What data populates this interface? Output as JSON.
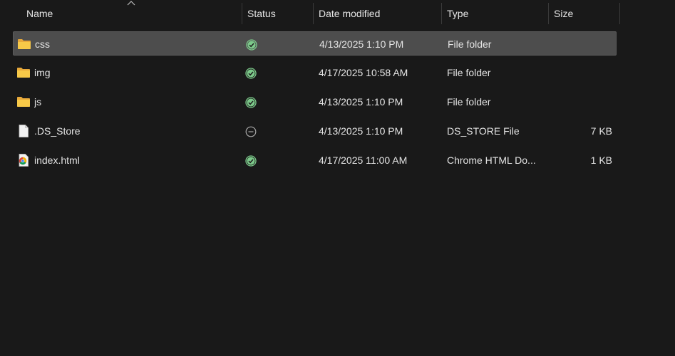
{
  "columns": {
    "name": "Name",
    "status": "Status",
    "date_modified": "Date modified",
    "type": "Type",
    "size": "Size"
  },
  "sort": {
    "column": "name",
    "direction": "ascending",
    "icon": "chevron-up-icon"
  },
  "files": [
    {
      "name": "css",
      "icon": "folder-icon",
      "status": "synced",
      "status_icon": "check-circle-icon",
      "date_modified": "4/13/2025 1:10 PM",
      "type": "File folder",
      "size": "",
      "selected": true
    },
    {
      "name": "img",
      "icon": "folder-icon",
      "status": "synced",
      "status_icon": "check-circle-icon",
      "date_modified": "4/17/2025 10:58 AM",
      "type": "File folder",
      "size": "",
      "selected": false
    },
    {
      "name": "js",
      "icon": "folder-icon",
      "status": "synced",
      "status_icon": "check-circle-icon",
      "date_modified": "4/13/2025 1:10 PM",
      "type": "File folder",
      "size": "",
      "selected": false
    },
    {
      "name": ".DS_Store",
      "icon": "document-icon",
      "status": "excluded",
      "status_icon": "minus-circle-icon",
      "date_modified": "4/13/2025 1:10 PM",
      "type": "DS_STORE File",
      "size": "7 KB",
      "selected": false
    },
    {
      "name": "index.html",
      "icon": "chrome-html-icon",
      "status": "synced",
      "status_icon": "check-circle-icon",
      "date_modified": "4/17/2025 11:00 AM",
      "type": "Chrome HTML Do...",
      "size": "1 KB",
      "selected": false
    }
  ],
  "colors": {
    "background": "#191919",
    "selected_row": "#4d4d4d",
    "text": "#e4e4e4",
    "synced_green": "#7cc98a",
    "folder_yellow": "#f5c542"
  }
}
